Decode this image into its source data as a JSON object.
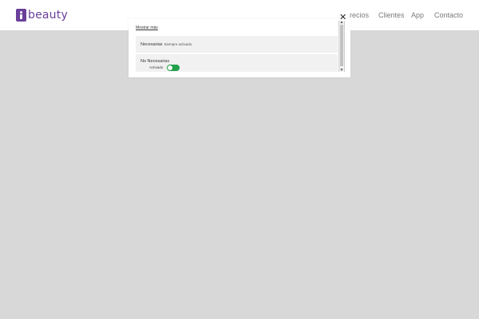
{
  "header": {
    "logo_text": "beauty",
    "nav": [
      {
        "label": "recios"
      },
      {
        "label": "Clientes"
      },
      {
        "label": "App"
      },
      {
        "label": "Contacto"
      }
    ]
  },
  "cookie_modal": {
    "show_more_label": "Mostrar más",
    "close_symbol": "✕",
    "categories": [
      {
        "title": "Necesarias",
        "status": "Siempre activado"
      },
      {
        "title": "No Necesarias",
        "toggle_label": "Activado",
        "toggle_on": true
      }
    ]
  },
  "colors": {
    "brand": "#6a3f9a",
    "toggle_on": "#22a04a",
    "background_overlay": "#d8d8d8"
  }
}
